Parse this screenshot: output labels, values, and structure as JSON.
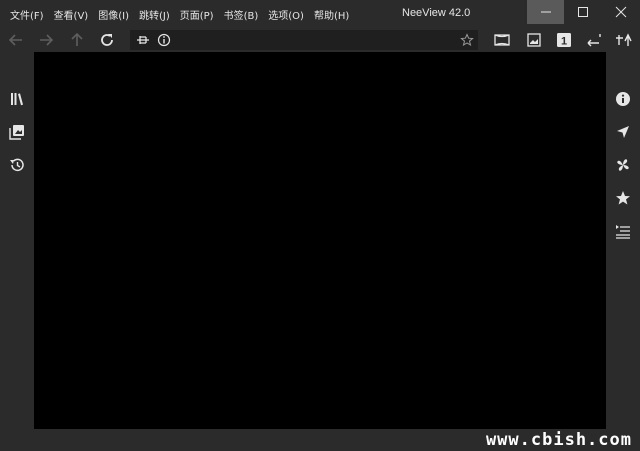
{
  "menu": {
    "items": [
      {
        "label": "文件(F)"
      },
      {
        "label": "查看(V)"
      },
      {
        "label": "图像(I)"
      },
      {
        "label": "跳转(J)"
      },
      {
        "label": "页面(P)"
      },
      {
        "label": "书签(B)"
      },
      {
        "label": "选项(O)"
      },
      {
        "label": "帮助(H)"
      }
    ]
  },
  "window": {
    "title": "NeeView 42.0"
  },
  "toolbar": {
    "address_value": "",
    "page_mode_badge": "1"
  },
  "watermark": "www.cbish.com",
  "colors": {
    "background": "#2b2b2b",
    "viewer": "#000000",
    "icon": "#e6e6e6",
    "disabled_icon": "#5e5e5e",
    "minimize_hover": "#5a5a5a"
  }
}
